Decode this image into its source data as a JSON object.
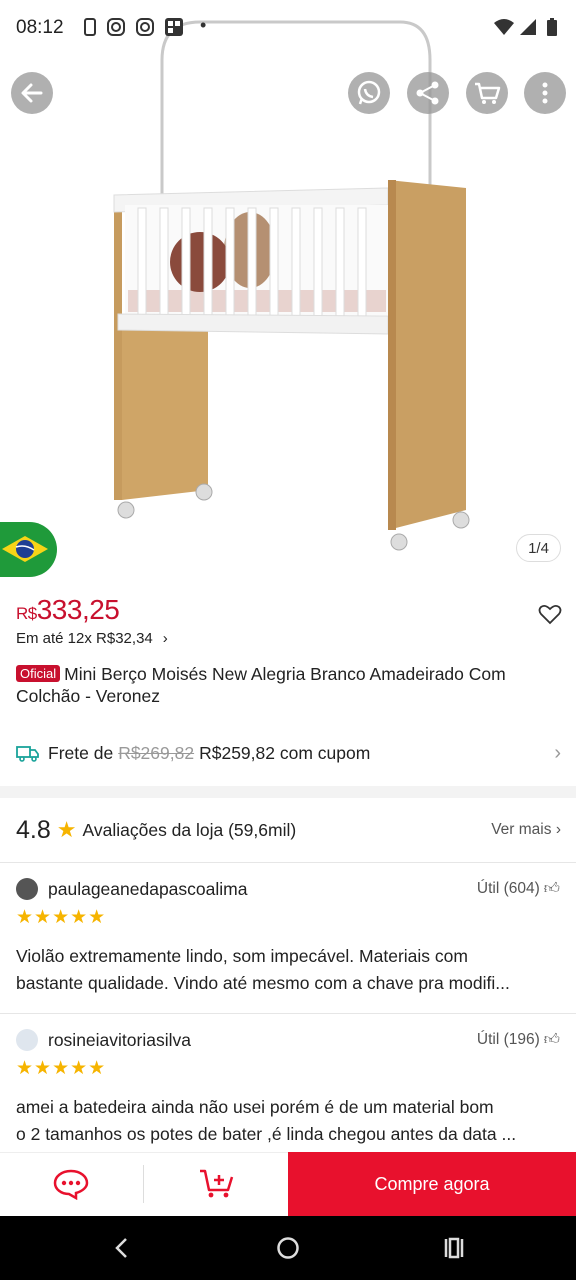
{
  "status_bar": {
    "time": "08:12"
  },
  "gallery": {
    "counter": "1/4",
    "product_image": "crib-image"
  },
  "product": {
    "currency": "R$",
    "price": "333,25",
    "installments": "Em até 12x R$32,34",
    "badge": "Oficial",
    "title": "Mini Berço Moisés New Alegria Branco Amadeirado Com Colchão - Veronez"
  },
  "shipping": {
    "label": "Frete de",
    "old_price": "R$269,82",
    "new_price": "R$259,82 com cupom"
  },
  "store_rating": {
    "score": "4.8",
    "label": "Avaliações da loja (59,6mil)",
    "see_more": "Ver mais"
  },
  "reviews": [
    {
      "user": "paulageanedapascoalima",
      "helpful": "Útil (604)",
      "stars": "★★★★★",
      "line1": "Violão extremamente lindo, som impecável. Materiais com",
      "line2": "bastante qualidade. Vindo até mesmo com a chave pra modifi..."
    },
    {
      "user": "rosineiavitoriasilva",
      "helpful": "Útil (196)",
      "stars": "★★★★★",
      "line1": "amei a batedeira  ainda não usei porém é de um material bom",
      "line2": "o 2 tamanhos os potes de bater ,é linda chegou antes da data ..."
    }
  ],
  "bottom_bar": {
    "buy_now": "Compre agora"
  },
  "colors": {
    "accent": "#e8112d",
    "price": "#c8102e",
    "star": "#f6b400"
  }
}
